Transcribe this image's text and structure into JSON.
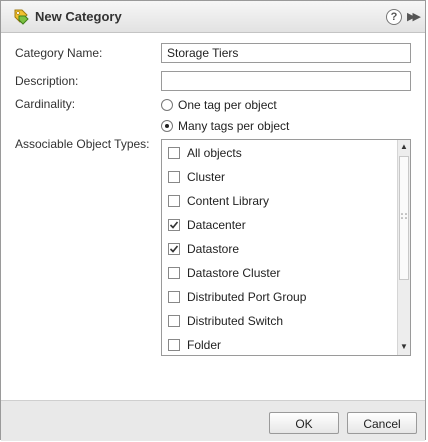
{
  "dialog": {
    "title": "New Category",
    "title_icon": "tag-category-icon",
    "help_label": "?",
    "expand_label": "▶▶"
  },
  "form": {
    "category_name_label": "Category Name:",
    "category_name_value": "Storage Tiers",
    "description_label": "Description:",
    "description_value": "",
    "cardinality_label": "Cardinality:",
    "cardinality_options": [
      {
        "label": "One tag per object",
        "selected": false
      },
      {
        "label": "Many tags per object",
        "selected": true
      }
    ],
    "object_types_label": "Associable Object Types:",
    "object_types": [
      {
        "label": "All objects",
        "checked": false
      },
      {
        "label": "Cluster",
        "checked": false
      },
      {
        "label": "Content Library",
        "checked": false
      },
      {
        "label": "Datacenter",
        "checked": true
      },
      {
        "label": "Datastore",
        "checked": true
      },
      {
        "label": "Datastore Cluster",
        "checked": false
      },
      {
        "label": "Distributed Port Group",
        "checked": false
      },
      {
        "label": "Distributed Switch",
        "checked": false
      },
      {
        "label": "Folder",
        "checked": false
      }
    ]
  },
  "footer": {
    "ok_label": "OK",
    "cancel_label": "Cancel"
  },
  "colors": {
    "titlebar_bg": "#e8e8e8",
    "footer_bg": "#e9e9e9",
    "checkmark": "#333333"
  }
}
